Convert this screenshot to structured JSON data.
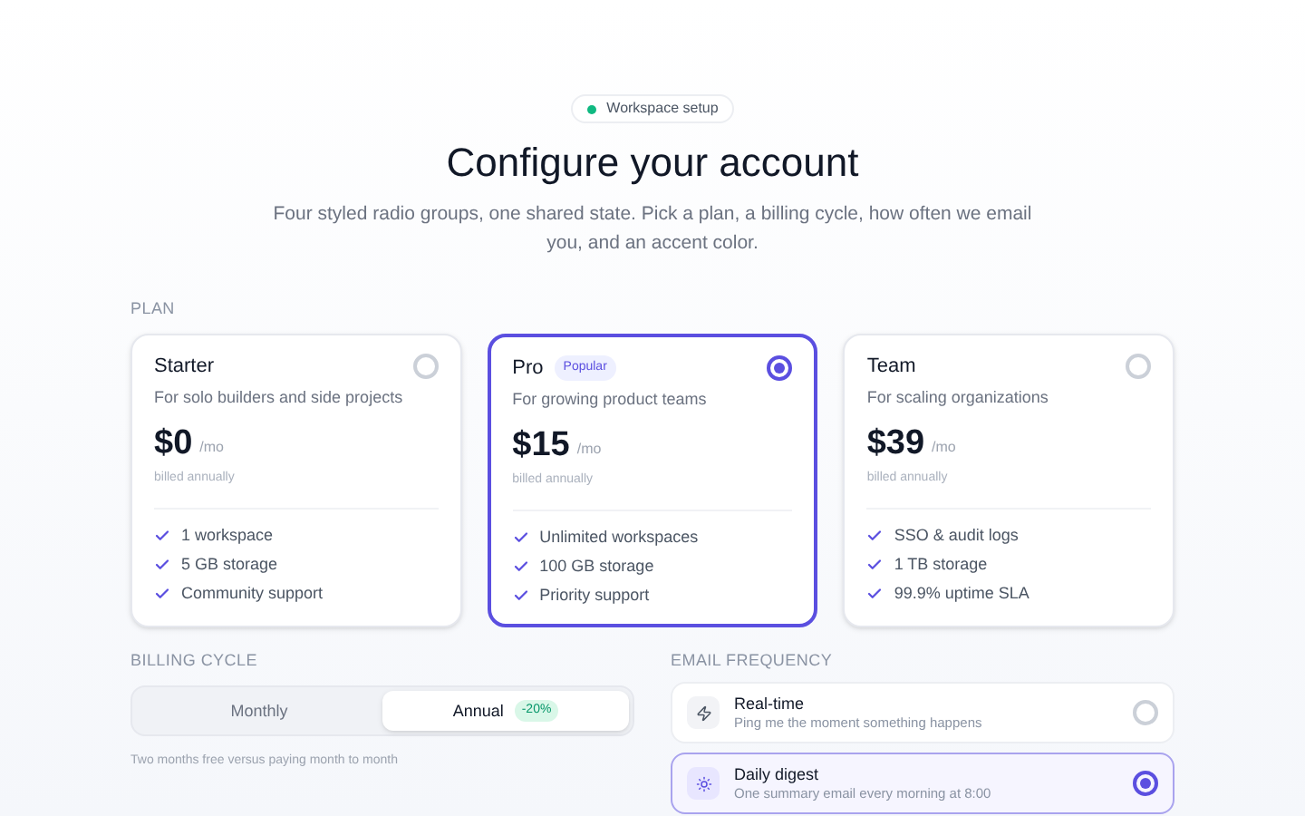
{
  "badge": {
    "label": "Workspace setup",
    "color": "#10b981"
  },
  "title": "Configure your account",
  "subtitle": "Four styled radio groups, one shared state. Pick a plan, a billing cycle, how often we email you, and an accent color.",
  "plan": {
    "label": "PLAN",
    "options": [
      {
        "name": "Starter",
        "description": "For solo builders and side projects",
        "price": "$0",
        "period": "/mo",
        "note": "billed annually",
        "features": [
          "1 workspace",
          "5 GB storage",
          "Community support"
        ],
        "selected": false
      },
      {
        "name": "Pro",
        "tag": "Popular",
        "description": "For growing product teams",
        "price": "$15",
        "period": "/mo",
        "note": "billed annually",
        "features": [
          "Unlimited workspaces",
          "100 GB storage",
          "Priority support"
        ],
        "selected": true
      },
      {
        "name": "Team",
        "description": "For scaling organizations",
        "price": "$39",
        "period": "/mo",
        "note": "billed annually",
        "features": [
          "SSO & audit logs",
          "1 TB storage",
          "99.9% uptime SLA"
        ],
        "selected": false
      }
    ]
  },
  "billing": {
    "label": "BILLING CYCLE",
    "options": [
      {
        "label": "Monthly",
        "selected": false
      },
      {
        "label": "Annual",
        "tag": "-20%",
        "selected": true
      }
    ],
    "hint": "Two months free versus paying month to month"
  },
  "email": {
    "label": "EMAIL FREQUENCY",
    "options": [
      {
        "kind": "bolt",
        "title": "Real-time",
        "description": "Ping me the moment something happens",
        "selected": false
      },
      {
        "kind": "sun",
        "title": "Daily digest",
        "description": "One summary email every morning at 8:00",
        "selected": true
      }
    ]
  }
}
